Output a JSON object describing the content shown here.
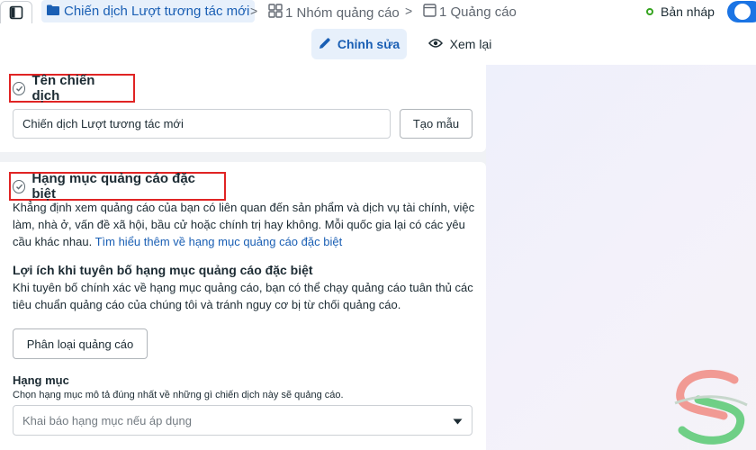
{
  "breadcrumb": {
    "campaign": "Chiến dịch Lượt tương tác mới",
    "ad_set": "1 Nhóm quảng cáo",
    "ad": "1 Quảng cáo",
    "separator": ">"
  },
  "status": {
    "label": "Bản nháp",
    "toggle_on": true
  },
  "mode_tabs": {
    "edit": "Chỉnh sửa",
    "review": "Xem lại"
  },
  "campaign_name": {
    "title": "Tên chiến dịch",
    "value": "Chiến dịch Lượt tương tác mới",
    "template_button": "Tạo mẫu"
  },
  "special_category": {
    "title": "Hạng mục quảng cáo đặc biệt",
    "description_line1": "Khẳng định xem quảng cáo của bạn có liên quan đến sản phẩm và dịch vụ tài chính, việc",
    "description_line2": "làm, nhà ở, vấn đề xã hội, bầu cử hoặc chính trị hay không. Mỗi quốc gia lại có các yêu",
    "description_line3": "cầu khác nhau.",
    "learn_more": "Tìm hiểu thêm về hạng mục quảng cáo đặc biệt",
    "benefit_title": "Lợi ích khi tuyên bố hạng mục quảng cáo đặc biệt",
    "benefit_line1": "Khi tuyên bố chính xác về hạng mục quảng cáo, bạn có thể chạy quảng cáo tuân thủ các",
    "benefit_line2": "tiêu chuẩn quảng cáo của chúng tôi và tránh nguy cơ bị từ chối quảng cáo.",
    "classify_button": "Phân loại quảng cáo",
    "category_label": "Hạng mục",
    "category_hint": "Chọn hạng mục mô tả đúng nhất về những gì chiến dịch này sẽ quảng cáo.",
    "category_placeholder": "Khai báo hạng mục nếu áp dụng"
  },
  "colors": {
    "accent": "#1a5fb4",
    "highlight_border": "#e02424",
    "status_green": "#36a420",
    "toggle_blue": "#1b74e4"
  },
  "icons": {
    "panel": "sidebar-panel-icon",
    "folder": "folder-icon",
    "ad_set": "grid-icon",
    "ad": "ad-frame-icon",
    "edit": "pencil-icon",
    "review": "eye-icon",
    "check": "check-circle-icon",
    "dropdown": "caret-down-icon"
  }
}
